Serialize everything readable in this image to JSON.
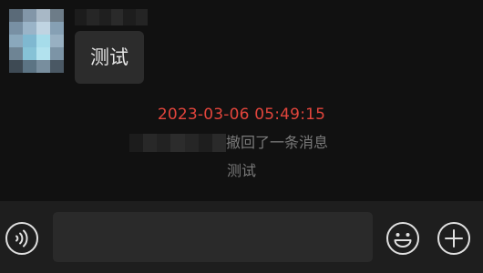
{
  "message": {
    "text": "测试"
  },
  "system": {
    "timestamp": "2023-03-06 05:49:15",
    "recall_notice": "撤回了一条消息",
    "recalled_content": "测试"
  },
  "input_bar": {
    "input_value": "",
    "voice_icon": "voice-icon",
    "emoji_icon": "emoji-icon",
    "plus_icon": "plus-icon"
  },
  "colors": {
    "background": "#111111",
    "bubble": "#2c2c2c",
    "timestamp": "#e2453c",
    "muted_text": "#7a7a7a",
    "input_bar": "#1e1e1e"
  }
}
